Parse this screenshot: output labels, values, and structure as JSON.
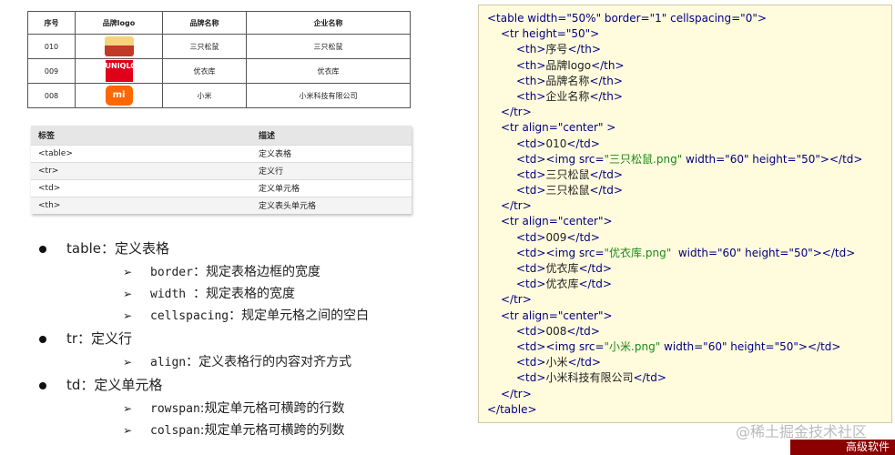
{
  "demo_table": {
    "headers": [
      "序号",
      "品牌logo",
      "品牌名称",
      "企业名称"
    ],
    "rows": [
      {
        "id": "010",
        "logo_text": "",
        "brand": "三只松鼠",
        "company": "三只松鼠"
      },
      {
        "id": "009",
        "logo_text": "UNIQLO",
        "brand": "优衣库",
        "company": "优衣库"
      },
      {
        "id": "008",
        "logo_text": "mi",
        "brand": "小米",
        "company": "小米科技有限公司"
      }
    ]
  },
  "tag_table": {
    "headers": [
      "标签",
      "描述"
    ],
    "rows": [
      {
        "tag": "<table>",
        "desc": "定义表格"
      },
      {
        "tag": "<tr>",
        "desc": "定义行"
      },
      {
        "tag": "<td>",
        "desc": "定义单元格"
      },
      {
        "tag": "<th>",
        "desc": "定义表头单元格"
      }
    ]
  },
  "notes": [
    {
      "title": "table：定义表格",
      "subs": [
        {
          "key": "border",
          "text": "：规定表格边框的宽度"
        },
        {
          "key": "width ",
          "text": "：规定表格的宽度"
        },
        {
          "key": "cellspacing",
          "text": "：规定单元格之间的空白"
        }
      ]
    },
    {
      "title": "tr：定义行",
      "subs": [
        {
          "key": "align",
          "text": "：定义表格行的内容对齐方式"
        }
      ]
    },
    {
      "title": "td：定义单元格",
      "subs": [
        {
          "key": "rowspan",
          "text": ":规定单元格可横跨的行数"
        },
        {
          "key": "colspan",
          "text": ":规定单元格可横跨的列数"
        }
      ]
    }
  ],
  "code": {
    "table_open": {
      "tag": "<table ",
      "a1": "width=\"50%\"",
      "a2": " border=\"1\"",
      "a3": " cellspacing=\"0\"",
      "end": ">"
    },
    "tr_header_open": {
      "tag": "<tr ",
      "attr": "height=\"50\"",
      "end": ">"
    },
    "th_lines": [
      {
        "open": "<th>",
        "text": "序号",
        "close": "</th>"
      },
      {
        "open": "<th>",
        "text": "品牌logo",
        "close": "</th>"
      },
      {
        "open": "<th>",
        "text": "品牌名称",
        "close": "</th>"
      },
      {
        "open": "<th>",
        "text": "企业名称",
        "close": "</th>"
      }
    ],
    "tr_close": "</tr>",
    "tr_row_open": {
      "tag": "<tr ",
      "attr": "align=\"center\"",
      "end": ">"
    },
    "tr_row_open_first": {
      "tag": "<tr ",
      "attr": "align=\"center\"",
      "end": " >"
    },
    "rows": [
      {
        "id": "010",
        "img_src": "\"三只松鼠.png\"",
        "img_attrs": " width=\"60\" height=\"50\"",
        "brand": "三只松鼠",
        "company": "三只松鼠"
      },
      {
        "id": "009",
        "img_src": "\"优衣库.png\"",
        "img_attrs": "  width=\"60\" height=\"50\"",
        "brand": "优衣库",
        "company": "优衣库"
      },
      {
        "id": "008",
        "img_src": "\"小米.png\"",
        "img_attrs": " width=\"60\" height=\"50\"",
        "brand": "小米",
        "company": "小米科技有限公司"
      }
    ],
    "td_open": "<td>",
    "td_close": "</td>",
    "img_open": "<img ",
    "src_label": "src=",
    "img_end": "></td>",
    "table_close": "</table>"
  },
  "watermark": "@稀土掘金技术社区",
  "banner": "高级软件",
  "colors": {
    "code_bg": "#fffbdc",
    "tag_color": "#000080",
    "value_color": "#1a8a1a",
    "banner_bg": "#8b0000"
  }
}
